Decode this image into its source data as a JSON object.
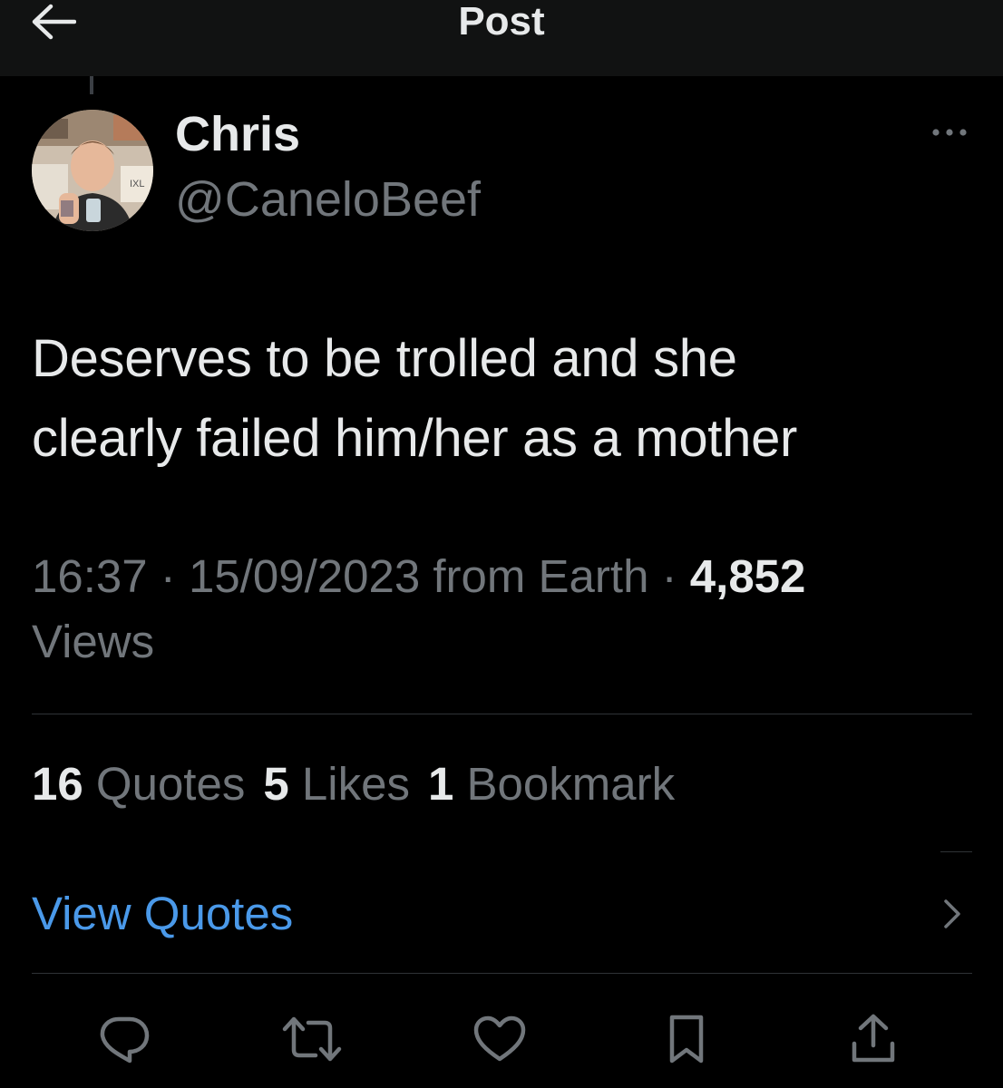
{
  "header": {
    "title": "Post",
    "back_icon": "arrow-left-icon"
  },
  "post": {
    "author": {
      "name": "Chris",
      "handle": "@CaneloBeef",
      "avatar_icon": "user-avatar"
    },
    "more_icon": "more-horizontal-icon",
    "text_line1": "Deserves to be trolled and she",
    "text_line2": "clearly failed him/her as a mother",
    "time": "16:37",
    "separator": "·",
    "date": "15/09/2023",
    "source": "from Earth",
    "views_count": "4,852",
    "views_label": "Views"
  },
  "stats": {
    "quotes_count": "16",
    "quotes_label": "Quotes",
    "likes_count": "5",
    "likes_label": "Likes",
    "bookmarks_count": "1",
    "bookmarks_label": "Bookmark"
  },
  "view_quotes": {
    "label": "View Quotes",
    "chevron_icon": "chevron-right-icon"
  },
  "actions": [
    {
      "icon": "reply-icon"
    },
    {
      "icon": "repost-icon"
    },
    {
      "icon": "like-icon"
    },
    {
      "icon": "bookmark-icon"
    },
    {
      "icon": "share-icon"
    }
  ],
  "colors": {
    "background": "#000000",
    "header_bg": "#111212",
    "primary_text": "#e7e9ea",
    "secondary_text": "#71767b",
    "link": "#4a99e9",
    "divider": "#2f3336"
  }
}
